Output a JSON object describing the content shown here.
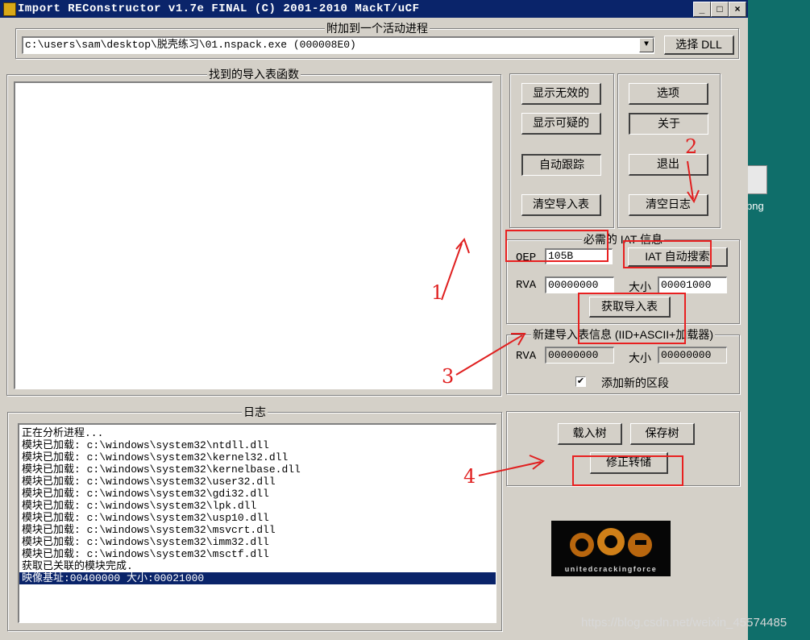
{
  "window": {
    "title": "Import REConstructor v1.7e FINAL (C) 2001-2010 MackT/uCF",
    "minimize": "_",
    "maximize": "□",
    "close": "×"
  },
  "attach": {
    "group_title": "附加到一个活动进程",
    "process_value": "c:\\users\\sam\\desktop\\脱壳练习\\01.nspack.exe (000008E0)",
    "select_dll": "选择 DLL"
  },
  "imports_panel": {
    "title": "找到的导入表函数"
  },
  "buttons_left": {
    "show_invalid": "显示无效的",
    "show_suspect": "显示可疑的",
    "auto_trace": "自动跟踪",
    "clear_imports": "清空导入表"
  },
  "buttons_right": {
    "options": "选项",
    "about": "关于",
    "exit": "退出",
    "clear_log": "清空日志"
  },
  "iat_info": {
    "title": "必需的 IAT 信息",
    "oep_label": "OEP",
    "oep_value": "105B",
    "iat_autosearch": "IAT 自动搜索",
    "rva_label": "RVA",
    "rva_value": "00000000",
    "size_label": "大小",
    "size_value": "00001000",
    "get_imports": "获取导入表"
  },
  "new_import": {
    "title": "新建导入表信息 (IID+ASCII+加载器)",
    "rva_label": "RVA",
    "rva_value": "00000000",
    "size_label": "大小",
    "size_value": "00000000",
    "add_section_label": "添加新的区段",
    "add_section_checked": true
  },
  "log": {
    "title": "日志",
    "lines": [
      "正在分析进程...",
      "模块已加载: c:\\windows\\system32\\ntdll.dll",
      "模块已加载: c:\\windows\\system32\\kernel32.dll",
      "模块已加载: c:\\windows\\system32\\kernelbase.dll",
      "模块已加载: c:\\windows\\system32\\user32.dll",
      "模块已加载: c:\\windows\\system32\\gdi32.dll",
      "模块已加载: c:\\windows\\system32\\lpk.dll",
      "模块已加载: c:\\windows\\system32\\usp10.dll",
      "模块已加载: c:\\windows\\system32\\msvcrt.dll",
      "模块已加载: c:\\windows\\system32\\imm32.dll",
      "模块已加载: c:\\windows\\system32\\msctf.dll",
      "获取已关联的模块完成.",
      "映像基址:00400000 大小:00021000"
    ],
    "selected_index": 12
  },
  "tree_panel": {
    "load_tree": "载入树",
    "save_tree": "保存树",
    "fix_dump": "修正转储"
  },
  "logo": {
    "text": "unitedcrackingforce"
  },
  "annotations": {
    "n1": "1",
    "n2": "2",
    "n3": "3",
    "n4": "4",
    "color": "#e02020"
  },
  "desktop": {
    "icon_label": "png"
  },
  "watermark": "https://blog.csdn.net/weixin_45574485"
}
